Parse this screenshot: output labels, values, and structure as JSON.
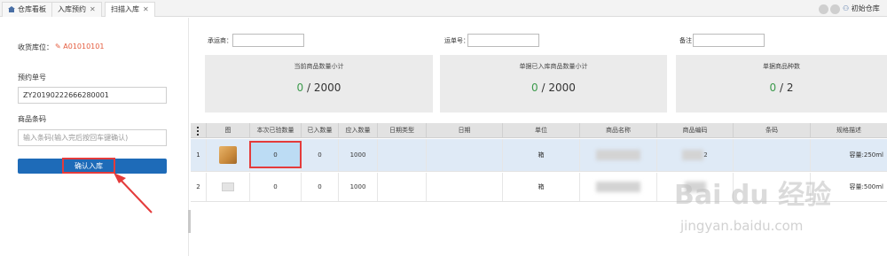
{
  "tabs": [
    {
      "label": "仓库看板",
      "active": false,
      "closable": false
    },
    {
      "label": "入库预约",
      "active": false,
      "closable": true
    },
    {
      "label": "扫描入库",
      "active": true,
      "closable": true
    }
  ],
  "top_right": {
    "label": "初始仓库"
  },
  "left": {
    "location_label": "收货库位：",
    "location_value": "A01010101",
    "order_label": "预约单号",
    "order_value": "ZY20190222666280001",
    "barcode_label": "商品条码",
    "barcode_placeholder": "输入条码(输入完后按回车键确认)",
    "confirm_label": "确认入库"
  },
  "filters": [
    {
      "label": "承运商："
    },
    {
      "label": "运单号："
    },
    {
      "label": "备注："
    }
  ],
  "cards": [
    {
      "title": "当前商品数量小计",
      "done": "0",
      "sep": "/",
      "total": "2000"
    },
    {
      "title": "单据已入库商品数量小计",
      "done": "0",
      "sep": "/",
      "total": "2000"
    },
    {
      "title": "单据商品种数",
      "done": "0",
      "sep": "/",
      "total": "2"
    }
  ],
  "table": {
    "headers": [
      "图",
      "本次已验数量",
      "已入数量",
      "应入数量",
      "日期类型",
      "日期",
      "单位",
      "商品名称",
      "商品编码",
      "条码",
      "规格描述"
    ],
    "rows": [
      {
        "index": "1",
        "scanned": "0",
        "received": "0",
        "expected": "1000",
        "date_type": "",
        "date": "",
        "unit": "箱",
        "name": "",
        "code_suffix": "2",
        "barcode": "",
        "spec": "容量:250ml"
      },
      {
        "index": "2",
        "scanned": "0",
        "received": "0",
        "expected": "1000",
        "date_type": "",
        "date": "",
        "unit": "箱",
        "name": "",
        "code_suffix": "",
        "barcode": "",
        "spec": "容量:500ml"
      }
    ]
  },
  "watermark": {
    "main": "Bai du 经验",
    "sub": "jingyan.baidu.com"
  },
  "colors": {
    "accent": "#1e6bb8",
    "highlight": "#e43b3b",
    "progress_green": "#3c9a4c"
  }
}
